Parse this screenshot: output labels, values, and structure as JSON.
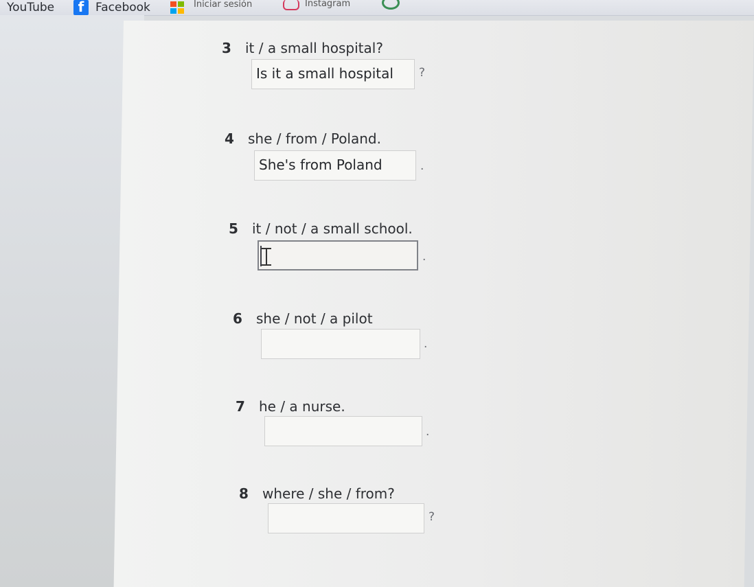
{
  "bookmarks": [
    {
      "label": "YouTube"
    },
    {
      "label": "Facebook"
    },
    {
      "label": "Iniciar sesión"
    },
    {
      "label": "Instagram"
    }
  ],
  "questions": [
    {
      "number": "3",
      "prompt": "it / a small hospital?",
      "answer": "Is it a small hospital",
      "end": "?"
    },
    {
      "number": "4",
      "prompt": "she / from / Poland.",
      "answer": "She's from Poland",
      "end": "."
    },
    {
      "number": "5",
      "prompt": "it / not / a small school.",
      "answer": "",
      "end": "."
    },
    {
      "number": "6",
      "prompt": "she / not / a pilot",
      "answer": "",
      "end": "."
    },
    {
      "number": "7",
      "prompt": "he / a nurse.",
      "answer": "",
      "end": "."
    },
    {
      "number": "8",
      "prompt": "where / she / from?",
      "answer": "",
      "end": "?"
    }
  ]
}
